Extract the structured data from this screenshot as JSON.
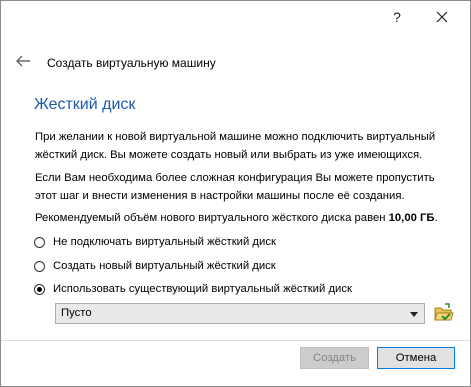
{
  "titlebar": {
    "help_label": "?",
    "help_icon": "question-mark-icon",
    "close_icon": "close-icon"
  },
  "header": {
    "back_icon": "back-arrow-icon",
    "wizard_title": "Создать виртуальную машину"
  },
  "page": {
    "title": "Жесткий диск",
    "paragraph1": "При желании к новой виртуальной машине можно подключить виртуальный жёсткий диск. Вы можете создать новый или выбрать из уже имеющихся.",
    "paragraph2": "Если Вам необходима более сложная конфигурация Вы можете пропустить этот шаг и внести изменения в настройки машины после её создания.",
    "recommended_prefix": "Рекомендуемый объём нового виртуального жёсткого диска равен",
    "recommended_size": "10,00 ГБ",
    "recommended_suffix": "."
  },
  "options": [
    {
      "label": "Не подключать виртуальный жёсткий диск",
      "checked": false
    },
    {
      "label": "Создать новый виртуальный жёсткий диск",
      "checked": false
    },
    {
      "label": "Использовать существующий виртуальный жёсткий диск",
      "checked": true
    }
  ],
  "disk_select": {
    "value": "Пусто",
    "folder_icon": "folder-open-icon"
  },
  "buttons": {
    "create": "Создать",
    "cancel": "Отмена"
  },
  "colors": {
    "title_accent": "#1d5aa8",
    "focus_border": "#0078d7",
    "disabled_text": "#838383"
  }
}
